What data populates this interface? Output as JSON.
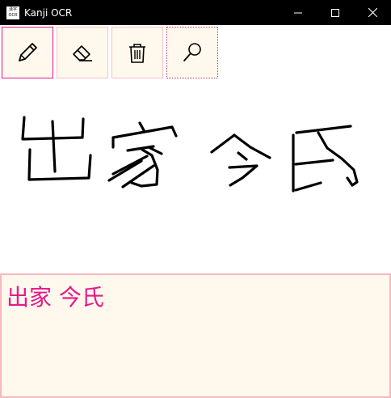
{
  "window": {
    "title": "Kanji OCR",
    "icon_text_top": "漢字",
    "icon_text_bottom": "OCR",
    "controls": [
      "minimize-icon",
      "maximize-icon",
      "close-icon"
    ]
  },
  "toolbar": {
    "tools": [
      {
        "name": "pen",
        "icon": "pencil-icon",
        "selected": true
      },
      {
        "name": "eraser",
        "icon": "eraser-icon",
        "selected": false
      },
      {
        "name": "clear",
        "icon": "trash-icon",
        "selected": false
      },
      {
        "name": "recognize",
        "icon": "magnifier-icon",
        "selected": false,
        "focused": true
      }
    ]
  },
  "result": {
    "text": "出家 今氏"
  },
  "colors": {
    "titlebar": "#000000",
    "accent": "#e4198b",
    "panel_bg": "#fff8ec",
    "panel_border": "#f7b6c0"
  }
}
